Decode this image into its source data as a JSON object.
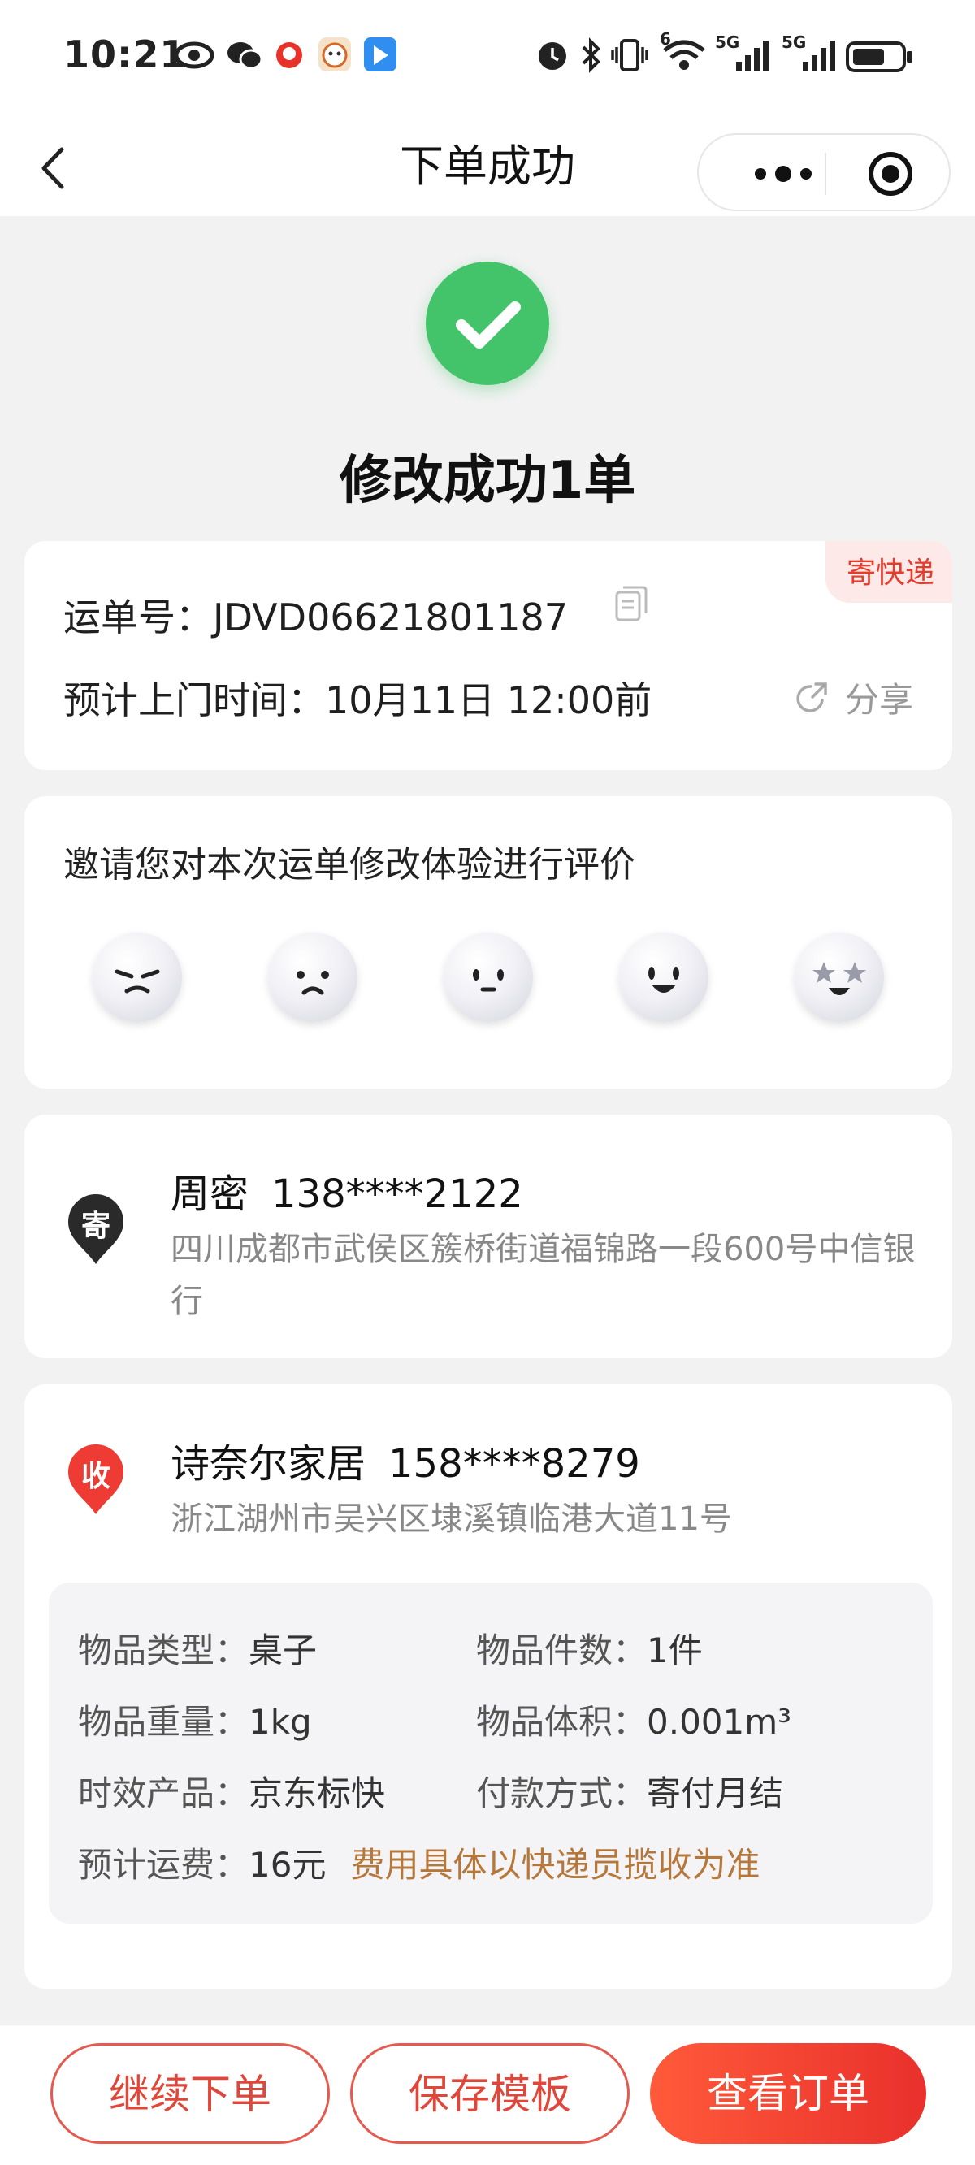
{
  "status_bar": {
    "time": "10:21",
    "left_icons": [
      "eye-icon",
      "wechat-icon",
      "app-icon-red",
      "app-icon-orange",
      "app-icon-blue"
    ],
    "right_icons": [
      "alarm-icon",
      "bluetooth-icon",
      "vibrate-icon",
      "wifi-icon",
      "signal-5g-icon",
      "signal-5g-icon",
      "battery-icon"
    ],
    "wifi_badge": "6",
    "signal_label_1": "5G",
    "signal_label_2": "5G"
  },
  "nav": {
    "title": "下单成功"
  },
  "success": {
    "title": "修改成功1单",
    "color": "#43c36a"
  },
  "waybill": {
    "tag": "寄快递",
    "number_label": "运单号：",
    "number": "JDVD06621801187",
    "pickup_label": "预计上门时间：",
    "pickup_time": "10月11日 12:00前",
    "share_label": "分享"
  },
  "rating": {
    "title": "邀请您对本次运单修改体验进行评价",
    "faces": [
      "angry-face-icon",
      "sad-face-icon",
      "neutral-face-icon",
      "happy-face-icon",
      "star-eyes-face-icon"
    ]
  },
  "sender": {
    "badge": "寄",
    "name": "周密",
    "phone": "138****2122",
    "address": "四川成都市武侯区簇桥街道福锦路一段600号中信银行"
  },
  "receiver": {
    "badge": "收",
    "name": "诗奈尔家居",
    "phone": "158****8279",
    "address": "浙江湖州市吴兴区埭溪镇临港大道11号"
  },
  "details": {
    "item_type_label": "物品类型：",
    "item_type": "桌子",
    "item_count_label": "物品件数：",
    "item_count": "1件",
    "weight_label": "物品重量：",
    "weight": "1kg",
    "volume_label": "物品体积：",
    "volume": "0.001m³",
    "product_label": "时效产品：",
    "product": "京东标快",
    "payment_label": "付款方式：",
    "payment": "寄付月结",
    "fee_label": "预计运费：",
    "fee": "16元",
    "fee_note": "费用具体以快递员揽收为准"
  },
  "actions": {
    "continue": "继续下单",
    "save_template": "保存模板",
    "view_order": "查看订单"
  },
  "colors": {
    "accent": "#e9302c",
    "tag_bg": "#fde9e7",
    "fee_note": "#b6783a"
  }
}
